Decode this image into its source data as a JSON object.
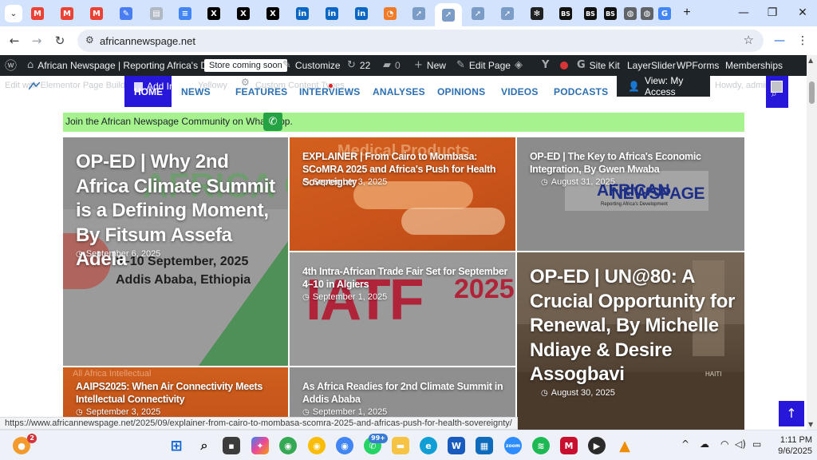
{
  "browser": {
    "tabs": [
      {
        "icon": "gmail-icon",
        "color": "#ea4335",
        "glyph": "M"
      },
      {
        "icon": "gmail-icon",
        "color": "#ea4335",
        "glyph": "M"
      },
      {
        "icon": "gmail-icon",
        "color": "#ea4335",
        "glyph": "M"
      },
      {
        "icon": "pen-icon",
        "color": "#4a7cf2",
        "glyph": "✎"
      },
      {
        "icon": "docs-icon",
        "color": "#b0b8c4",
        "glyph": "▤"
      },
      {
        "icon": "google-docs-icon",
        "color": "#4285f4",
        "glyph": "≡"
      },
      {
        "icon": "x-icon",
        "color": "#000000",
        "glyph": "X"
      },
      {
        "icon": "x-icon",
        "color": "#000000",
        "glyph": "X"
      },
      {
        "icon": "x-icon",
        "color": "#000000",
        "glyph": "X"
      },
      {
        "icon": "linkedin-icon",
        "color": "#0a66c2",
        "glyph": "in"
      },
      {
        "icon": "linkedin-icon",
        "color": "#0a66c2",
        "glyph": "in"
      },
      {
        "icon": "linkedin-icon",
        "color": "#0a66c2",
        "glyph": "in"
      },
      {
        "icon": "orange-site-icon",
        "color": "#f07c2a",
        "glyph": "◔"
      },
      {
        "icon": "africannewspage-icon",
        "color": "#7a9cc6",
        "glyph": "➚"
      },
      {
        "icon": "africannewspage-icon",
        "color": "#7a9cc6",
        "glyph": "➚"
      },
      {
        "icon": "africannewspage-icon",
        "color": "#7a9cc6",
        "glyph": "➚"
      },
      {
        "icon": "africannewspage-icon",
        "color": "#7a9cc6",
        "glyph": "➚"
      },
      {
        "icon": "openai-icon",
        "color": "#202123",
        "glyph": "✻"
      },
      {
        "icon": "bs-icon",
        "color": "#111111",
        "glyph": "BS"
      },
      {
        "icon": "bs-icon",
        "color": "#111111",
        "glyph": "BS"
      },
      {
        "icon": "bs-icon",
        "color": "#111111",
        "glyph": "BS"
      },
      {
        "icon": "globe-icon",
        "color": "#5f6368",
        "glyph": "◍"
      },
      {
        "icon": "globe-icon",
        "color": "#5f6368",
        "glyph": "◍"
      },
      {
        "icon": "google-icon",
        "color": "#4285f4",
        "glyph": "G"
      }
    ],
    "active_tab_index": 14,
    "new_tab_glyph": "+",
    "window_controls": {
      "minimize": "—",
      "maximize": "❐",
      "close": "✕"
    },
    "url": "africannewspage.net",
    "nav": {
      "back": "←",
      "forward": "→",
      "reload": "↻"
    },
    "star_glyph": "☆",
    "status_url": "https://www.africannewspage.net/2025/09/explainer-from-cairo-to-mombasa-scomra-2025-and-africas-push-for-health-sovereignty/"
  },
  "adminbar": {
    "site_name": "African Newspage | Reporting Africa's De...",
    "store_badge": "Store coming soon",
    "customize": "Customize",
    "updates_count": "22",
    "comments_count": "0",
    "new": "New",
    "edit_page": "Edit Page",
    "site_kit": "Site Kit",
    "layerslider": "LayerSlider",
    "wpforms": "WPForms",
    "memberships": "Memberships"
  },
  "header": {
    "ghost_text_left": "Edit with Elementor  Page Builder",
    "ghost_text_mid": "Yellowy",
    "ghost_text_mid2": "Custom Content Types",
    "ghost_text_right": "Howdy, admin",
    "add_insert": "Add Ins",
    "view_as": "View: My Access",
    "nav": [
      "HOME",
      "NEWS",
      "FEATURES",
      "INTERVIEWS",
      "ANALYSES",
      "OPINIONS",
      "VIDEOS",
      "PODCASTS"
    ]
  },
  "whatsapp_bar": {
    "text": "Join the African Newspage Community on WhatsApp."
  },
  "cards": [
    {
      "title": "OP-ED | Why 2nd Africa Climate Summit is a Defining Moment, By Fitsum Assefa Adela",
      "date": "September 6, 2025",
      "image_text": "8–10 September, 2025",
      "image_text2": "Addis Ababa, Ethiopia",
      "image_text3": "AFRICA CLIM"
    },
    {
      "title": "EXPLAINER | From Cairo to Mombasa: SCoMRA 2025 and Africa's Push for Health Sovereignty",
      "date": "September 3, 2025",
      "image_text": "Medical Products"
    },
    {
      "title": "OP-ED | The Key to Africa's Economic Integration, By Gwen Mwaba",
      "date": "August 31, 2025",
      "image_text": "AFRICAN",
      "image_text2": "NEWSPAGE",
      "image_text3": "Reporting Africa's Development"
    },
    {
      "title": "4th Intra-African Trade Fair Set for September 4–10 in Algiers",
      "date": "September 1, 2025",
      "image_text": "IATF",
      "image_text2": "2025"
    },
    {
      "title": "OP-ED | UN@80: A Crucial Opportunity for Renewal, By Michelle Ndiaye & Desire Assogbavi",
      "date": "August 30, 2025",
      "image_text": "HAITI"
    },
    {
      "title": "AAIPS2025: When Air Connectivity Meets Intellectual Connectivity",
      "date": "September 3, 2025",
      "image_text": "All Africa Intellectual"
    },
    {
      "title": "As Africa Readies for 2nd Climate Summit in Addis Ababa",
      "date": "September 1, 2025"
    }
  ],
  "taskbar": {
    "time": "1:11 PM",
    "date": "9/6/2025",
    "mail_badge": "2",
    "whatsapp_badge": "99+",
    "tray_up": "^"
  }
}
